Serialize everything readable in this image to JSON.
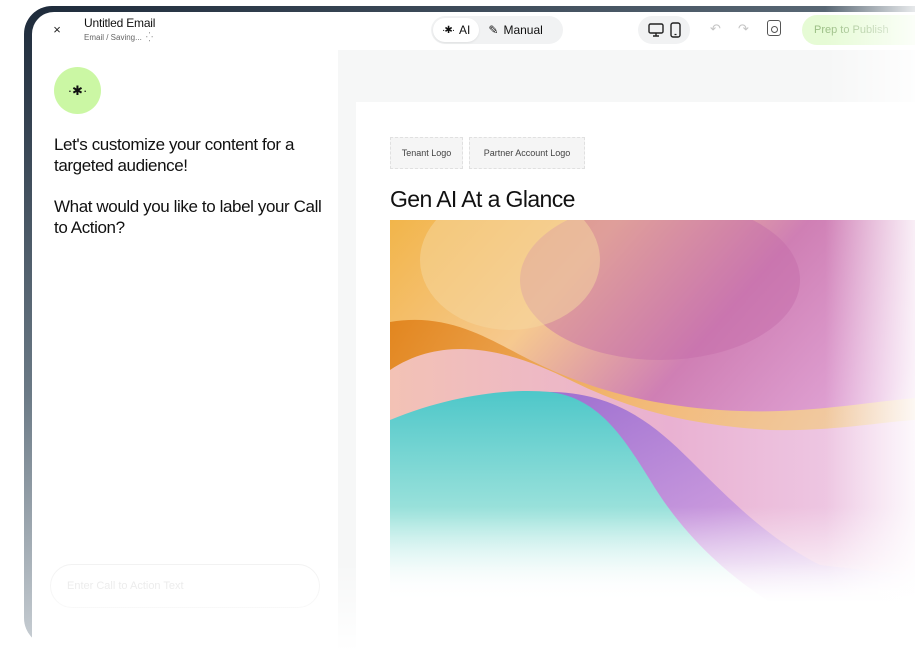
{
  "header": {
    "close_label": "×",
    "title": "Untitled Email",
    "subtitle": "Email / Saving...",
    "modes": [
      {
        "label": "AI",
        "icon": "sparkle-icon",
        "active": true
      },
      {
        "label": "Manual",
        "icon": "pencil-icon",
        "active": false
      }
    ],
    "devices": [
      "desktop-icon",
      "mobile-icon"
    ],
    "publish_label": "Prep to Publish"
  },
  "chat": {
    "message1": "Let's customize your content for a targeted audience!",
    "message2": "What would you like to label your Call to Action?",
    "input_placeholder": "Enter Call to Action Text"
  },
  "email": {
    "tenant_logo": "Tenant Logo",
    "partner_logo": "Partner Account Logo",
    "heading": "Gen AI At a Glance"
  },
  "colors": {
    "accent": "#cbf7a4",
    "publish_bg": "#e6fbd5",
    "canvas_bg": "#f6f7f7"
  }
}
